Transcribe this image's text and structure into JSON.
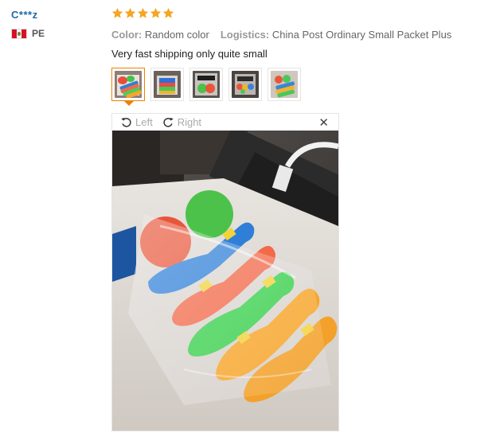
{
  "reviewer": {
    "name": "C***z",
    "country_code": "PE"
  },
  "review": {
    "rating": 5,
    "color_label": "Color:",
    "color_value": "Random color",
    "logistics_label": "Logistics:",
    "logistics_value": "China Post Ordinary Small Packet Plus",
    "text": "Very fast shipping only quite small"
  },
  "colors": {
    "star": "#f5a623",
    "accent": "#f08000",
    "username": "#2266aa"
  },
  "thumbnails": [
    {
      "active": true
    },
    {
      "active": false
    },
    {
      "active": false
    },
    {
      "active": false
    },
    {
      "active": false
    }
  ],
  "viewer": {
    "rotate_left": "Left",
    "rotate_right": "Right",
    "close_icon": "close-icon"
  }
}
